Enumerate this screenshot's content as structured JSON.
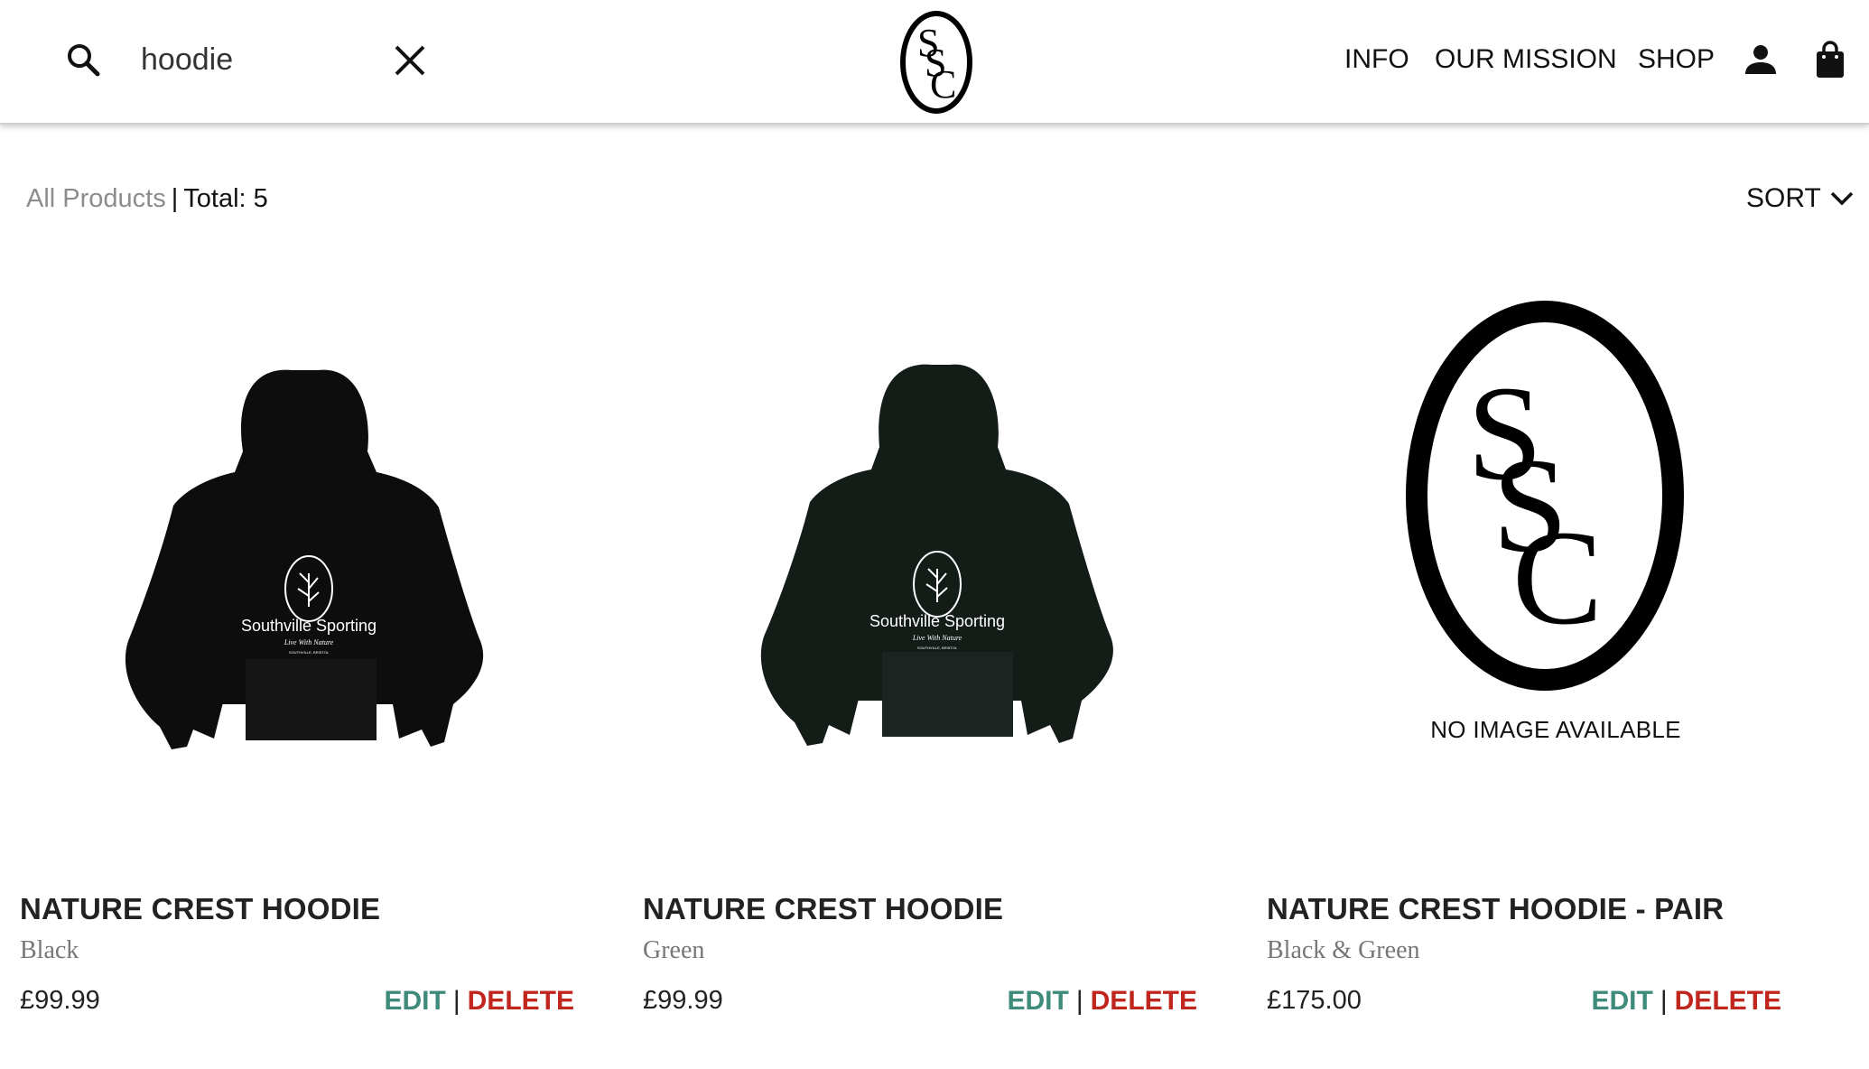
{
  "header": {
    "search_value": "hoodie",
    "logo_text": "SSC",
    "nav": [
      "INFO",
      "OUR MISSION",
      "SHOP"
    ]
  },
  "toolbar": {
    "breadcrumb_all": "All Products",
    "breadcrumb_sep": "|",
    "total_label": "Total: 5",
    "sort_label": "SORT"
  },
  "products": [
    {
      "name": "NATURE CREST HOODIE",
      "color": "Black",
      "price": "£99.99",
      "image": {
        "brand": "Southville Sporting",
        "tagline": "Live With Nature",
        "location": "SOUTHVILLE, BRISTOL",
        "garment_color": "#0d0d0d"
      },
      "edit_label": "EDIT",
      "delete_label": "DELETE"
    },
    {
      "name": "NATURE CREST HOODIE",
      "color": "Green",
      "price": "£99.99",
      "image": {
        "brand": "Southville Sporting",
        "tagline": "Live With Nature",
        "location": "SOUTHVILLE, BRISTOL",
        "garment_color": "#141c18"
      },
      "edit_label": "EDIT",
      "delete_label": "DELETE"
    },
    {
      "name": "NATURE CREST HOODIE - PAIR",
      "color": "Black & Green",
      "price": "£175.00",
      "image": {
        "placeholder": "NO IMAGE AVAILABLE",
        "logo_text": "SSC"
      },
      "edit_label": "EDIT",
      "delete_label": "DELETE"
    }
  ],
  "colors": {
    "edit": "#3e8a7b",
    "delete": "#c0261e",
    "muted": "#8c8c8c"
  },
  "icons": [
    "search-icon",
    "close-icon",
    "user-icon",
    "shopping-bag-icon",
    "chevron-down-icon"
  ]
}
